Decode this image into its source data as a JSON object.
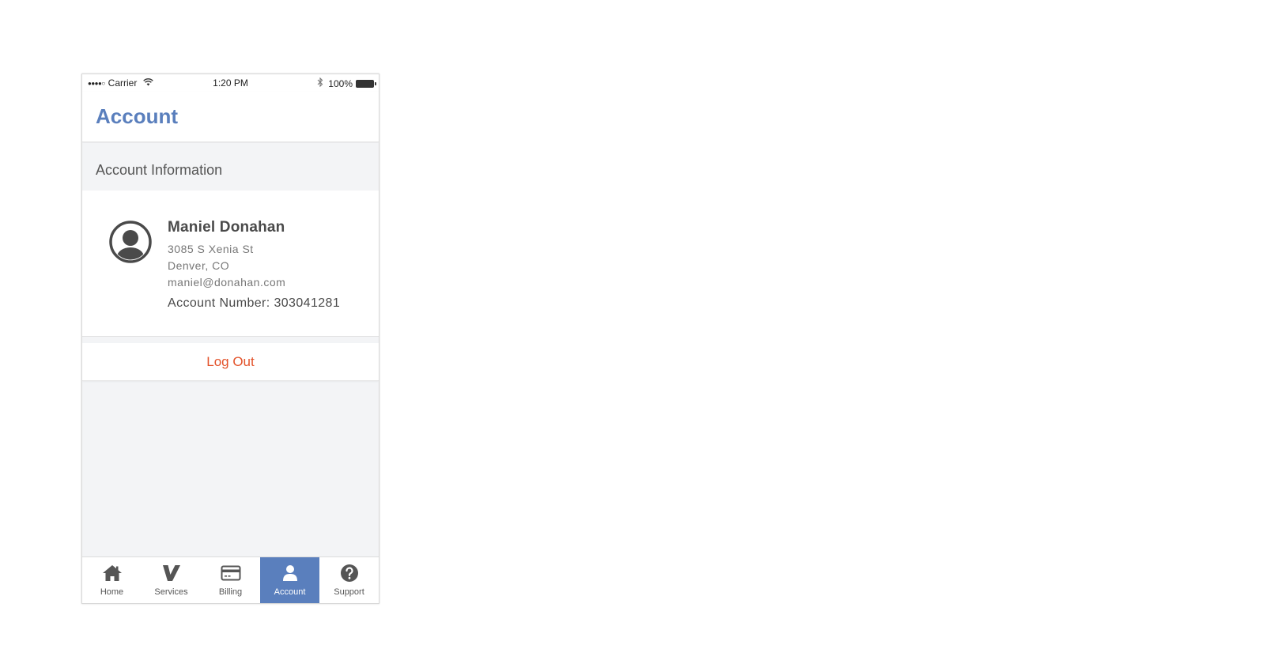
{
  "status_bar": {
    "signal": "●●●●○",
    "carrier": "Carrier",
    "time": "1:20 PM",
    "battery": "100%"
  },
  "header": {
    "title": "Account"
  },
  "section": {
    "title": "Account Information"
  },
  "account": {
    "name": "Maniel Donahan",
    "street": "3085 S Xenia St",
    "city": "Denver, CO",
    "email": "maniel@donahan.com",
    "account_number": "Account Number: 303041281"
  },
  "logout": {
    "label": "Log Out",
    "color": "#e3532b"
  },
  "tabs": [
    {
      "label": "Home",
      "icon": "home-icon"
    },
    {
      "label": "Services",
      "icon": "services-v-icon"
    },
    {
      "label": "Billing",
      "icon": "credit-card-icon"
    },
    {
      "label": "Account",
      "icon": "person-icon",
      "active": true
    },
    {
      "label": "Support",
      "icon": "question-icon"
    }
  ],
  "colors": {
    "accent": "#5a7fbd",
    "background": "#f3f4f6"
  }
}
